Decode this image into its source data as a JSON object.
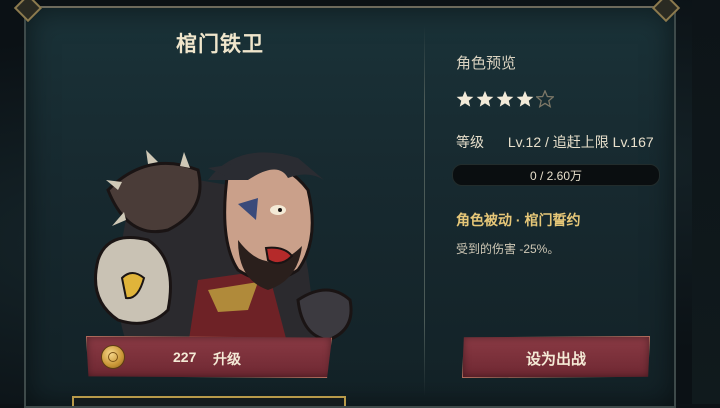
{
  "hero": {
    "name": "棺门铁卫",
    "upgrade": {
      "count": "227",
      "label": "升级",
      "coin_icon": "coin-icon"
    }
  },
  "info": {
    "section_title": "角色预览",
    "stars": {
      "filled": 4,
      "total": 5
    },
    "level": {
      "key": "等级",
      "value": "Lv.12 / 追赶上限 Lv.167"
    },
    "xp": {
      "text": "0 / 2.60万",
      "progress": 0
    },
    "passive": {
      "title": "角色被动 · 棺门誓约",
      "desc": "受到的伤害 -25%。"
    },
    "deploy_label": "设为出战"
  },
  "colors": {
    "panel": "#17292f",
    "button": "#7a303a",
    "gold": "#e6c778",
    "star_filled": "#f2ead8",
    "star_empty": "#7d7868"
  }
}
